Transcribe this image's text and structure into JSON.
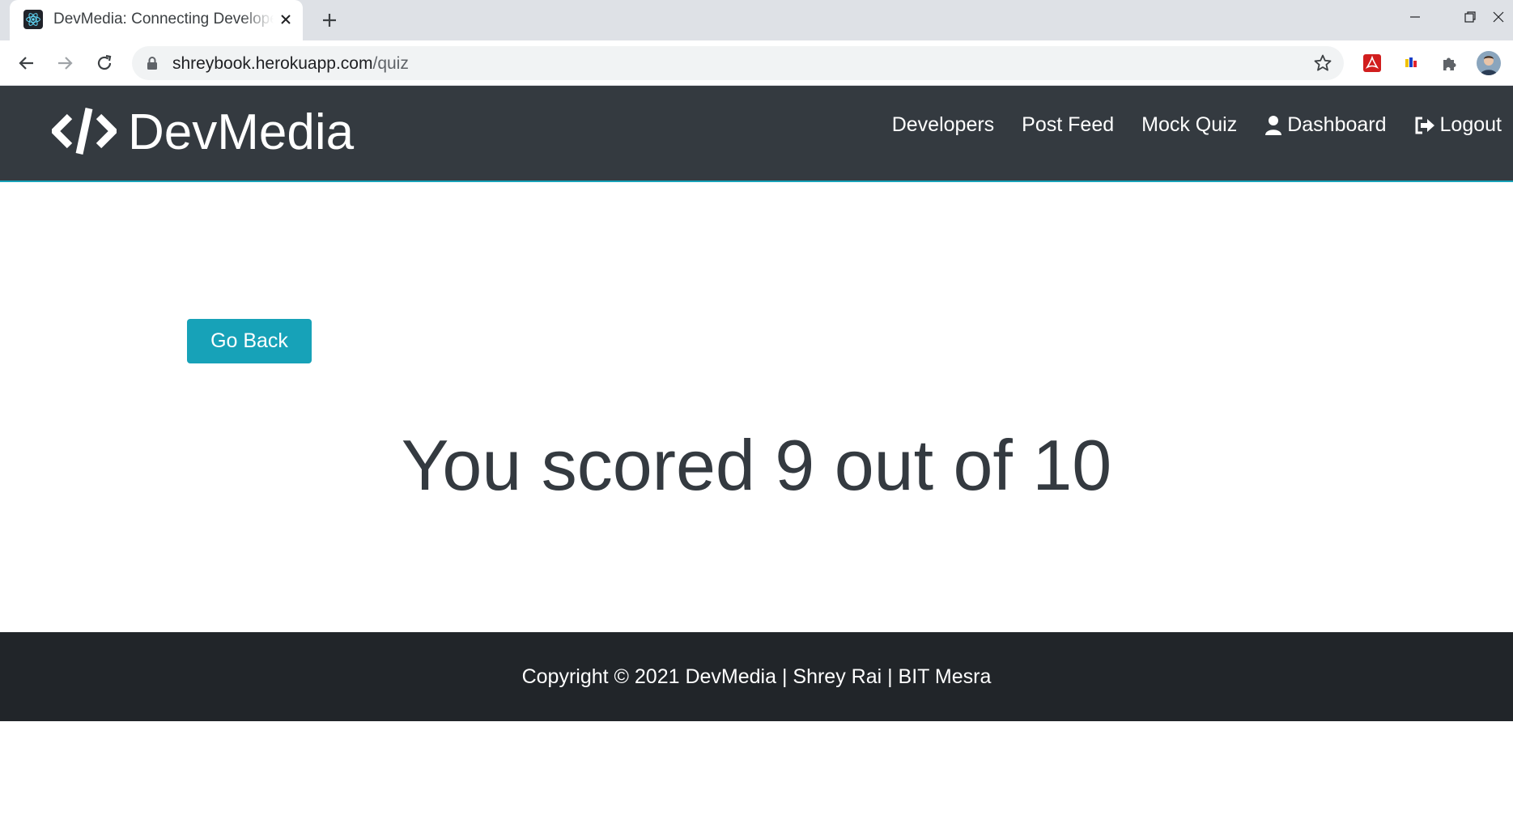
{
  "browser": {
    "tab_title": "DevMedia: Connecting Developers",
    "url_host": "shreybook.herokuapp.com",
    "url_path": "/quiz",
    "favicon": "react-icon",
    "extensions": [
      "adobe-pdf-icon",
      "color-extension-icon",
      "puzzle-icon"
    ]
  },
  "navbar": {
    "brand": "DevMedia",
    "brand_icon": "code-icon",
    "links": {
      "developers": "Developers",
      "post_feed": "Post Feed",
      "mock_quiz": "Mock Quiz",
      "dashboard": "Dashboard",
      "logout": "Logout"
    }
  },
  "main": {
    "go_back_label": "Go Back",
    "score_text": "You scored 9 out of 10"
  },
  "footer": {
    "text": "Copyright © 2021 DevMedia | Shrey Rai | BIT Mesra"
  },
  "colors": {
    "navbar_bg": "#343a40",
    "accent": "#17a2b8",
    "footer_bg": "#212529"
  }
}
